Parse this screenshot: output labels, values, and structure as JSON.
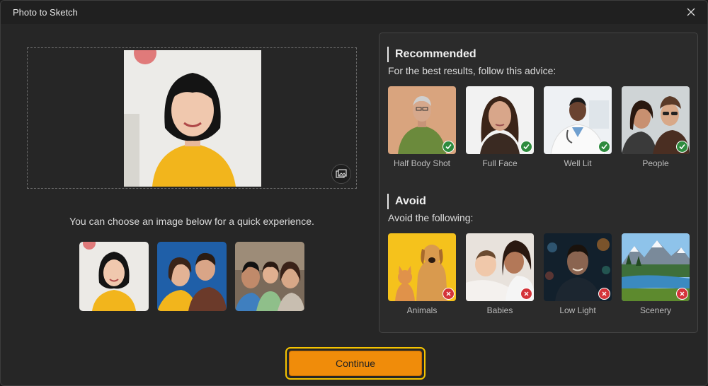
{
  "window": {
    "title": "Photo to Sketch",
    "close_icon": "close-icon"
  },
  "editor": {
    "swap_icon": "replace-image-icon"
  },
  "quick": {
    "text": "You can choose an image below for a quick experience.",
    "samples": [
      {
        "name": "sample-portrait-woman"
      },
      {
        "name": "sample-couple"
      },
      {
        "name": "sample-family"
      }
    ]
  },
  "recommended": {
    "title": "Recommended",
    "subtitle": "For the best results, follow this advice:",
    "items": [
      {
        "label": "Half Body Shot"
      },
      {
        "label": "Full Face"
      },
      {
        "label": "Well Lit"
      },
      {
        "label": "People"
      }
    ]
  },
  "avoid": {
    "title": "Avoid",
    "subtitle": "Avoid the following:",
    "items": [
      {
        "label": "Animals"
      },
      {
        "label": "Babies"
      },
      {
        "label": "Low Light"
      },
      {
        "label": "Scenery"
      }
    ]
  },
  "footer": {
    "continue_label": "Continue"
  },
  "colors": {
    "accent": "#f08c0a",
    "focus_ring": "#f5c400",
    "ok": "#2e8b3e",
    "no": "#d4343a"
  }
}
